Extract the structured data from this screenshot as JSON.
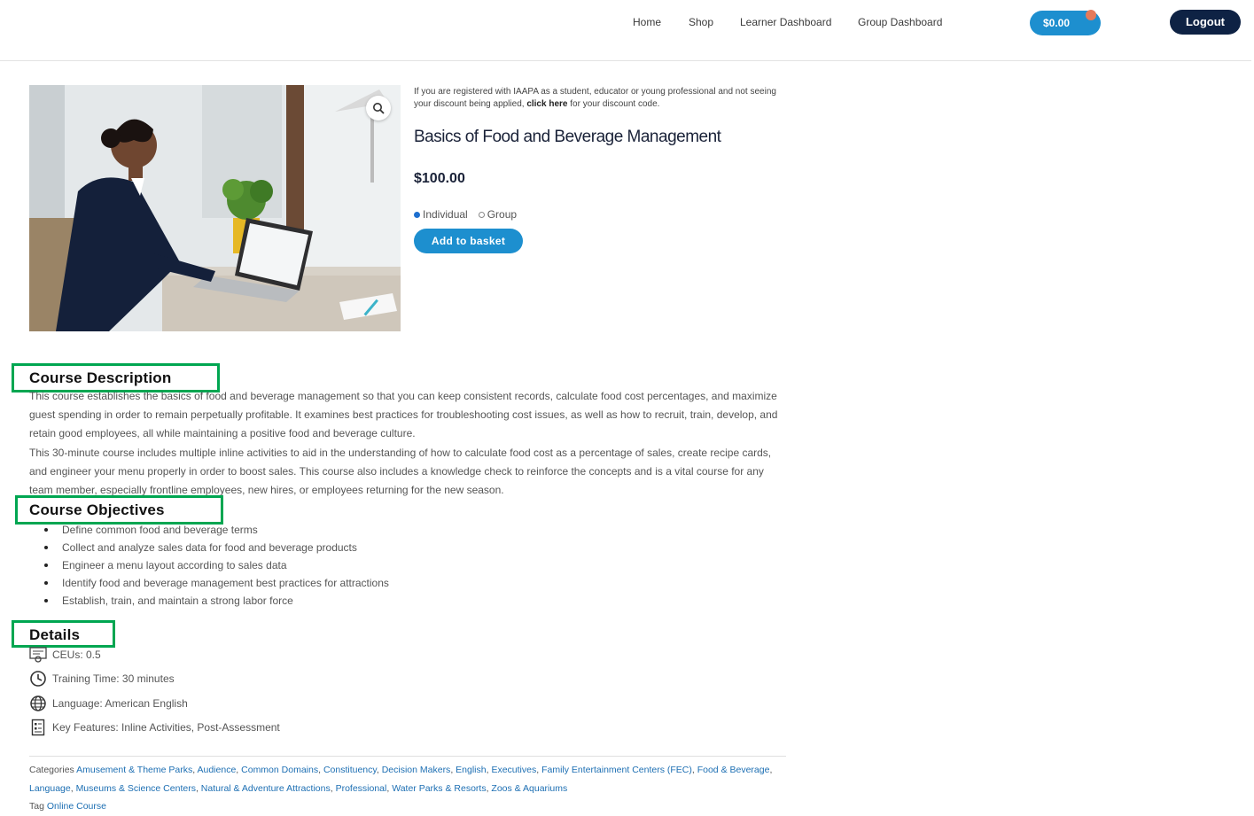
{
  "header": {
    "nav": [
      "Home",
      "Shop",
      "Learner Dashboard",
      "Group Dashboard"
    ],
    "cart_total": "$0.00",
    "logout_label": "Logout"
  },
  "product": {
    "notice_text": "If you are registered with IAAPA as a student, educator or young professional and not seeing your discount being applied,",
    "notice_link": "click here",
    "notice_suffix": "for your discount code.",
    "title": "Basics of Food and Beverage Management",
    "price": "$100.00",
    "options": [
      "Individual",
      "Group"
    ],
    "selected_option": "Individual",
    "add_to_basket": "Add to basket"
  },
  "description": {
    "heading": "Course Description",
    "paragraphs": [
      "This course establishes the basics of food and beverage management so that you can keep consistent records, calculate food cost percentages, and maximize guest spending in order to remain perpetually profitable. It examines best practices for troubleshooting cost issues, as well as how to recruit, train, develop, and retain good employees, all while maintaining a positive food and beverage culture.",
      "This 30-minute course includes multiple inline activities to aid in the understanding of how to calculate food cost as a percentage of sales, create recipe cards, and engineer your menu properly in order to boost sales. This course also includes a knowledge check to reinforce the concepts and is a vital course for any team member, especially frontline employees, new hires, or employees returning for the new season."
    ]
  },
  "objectives": {
    "heading": "Course Objectives",
    "items": [
      "Define common food and beverage terms",
      "Collect and analyze sales data for food and beverage products",
      "Engineer a menu layout according to sales data",
      "Identify food and beverage management best practices for attractions",
      "Establish, train, and maintain a strong labor force"
    ]
  },
  "details": {
    "heading": "Details",
    "items": [
      {
        "icon": "certificate-icon",
        "text": "CEUs: 0.5"
      },
      {
        "icon": "clock-icon",
        "text": "Training Time: 30 minutes"
      },
      {
        "icon": "globe-icon",
        "text": "Language: American English"
      },
      {
        "icon": "checklist-icon",
        "text": "Key Features: Inline Activities, Post-Assessment"
      }
    ]
  },
  "meta": {
    "categories_label": "Categories",
    "categories": [
      "Amusement & Theme Parks",
      "Audience",
      "Common Domains",
      "Constituency",
      "Decision Makers",
      "English",
      "Executives",
      "Family Entertainment Centers (FEC)",
      "Food & Beverage",
      "Language",
      "Museums & Science Centers",
      "Natural & Adventure Attractions",
      "Professional",
      "Water Parks & Resorts",
      "Zoos & Aquariums"
    ],
    "tag_label": "Tag",
    "tag": "Online Course"
  },
  "colors": {
    "accent": "#1d8fcf",
    "navy": "#0e2244",
    "highlight": "#00a651"
  }
}
